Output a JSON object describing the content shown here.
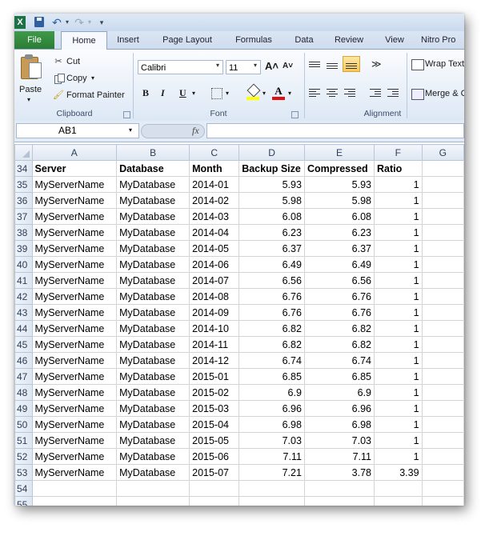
{
  "qat": {
    "app_icon": "X",
    "undo_glyph": "↶",
    "redo_glyph": "↷",
    "dropdown_glyph": "▾"
  },
  "tabs": {
    "file": "File",
    "home": "Home",
    "insert": "Insert",
    "page_layout": "Page Layout",
    "formulas": "Formulas",
    "data": "Data",
    "review": "Review",
    "view": "View",
    "nitro": "Nitro Pro"
  },
  "clipboard": {
    "paste": "Paste",
    "cut": "Cut",
    "copy": "Copy",
    "format_painter": "Format Painter",
    "label": "Clipboard"
  },
  "font": {
    "name": "Calibri",
    "size": "11",
    "grow": "A˄",
    "shrink": "A˅",
    "bold": "B",
    "italic": "I",
    "underline": "U",
    "color_letter": "A",
    "label": "Font"
  },
  "alignment": {
    "wrap_text": "Wrap Text",
    "merge": "Merge & Center",
    "label": "Alignment",
    "orientation_glyph": "≫"
  },
  "formula_bar": {
    "name_box": "AB1",
    "fx": "fx",
    "formula": ""
  },
  "sheet": {
    "columns": [
      "A",
      "B",
      "C",
      "D",
      "E",
      "F",
      "G"
    ],
    "header_row": {
      "num": "34",
      "cells": [
        "Server",
        "Database",
        "Month",
        "Backup Size",
        "Compressed",
        "Ratio",
        ""
      ]
    },
    "rows": [
      {
        "num": "35",
        "server": "MyServerName",
        "database": "MyDatabase",
        "month": "2014-01",
        "backup": "5.93",
        "compressed": "5.93",
        "ratio": "1"
      },
      {
        "num": "36",
        "server": "MyServerName",
        "database": "MyDatabase",
        "month": "2014-02",
        "backup": "5.98",
        "compressed": "5.98",
        "ratio": "1"
      },
      {
        "num": "37",
        "server": "MyServerName",
        "database": "MyDatabase",
        "month": "2014-03",
        "backup": "6.08",
        "compressed": "6.08",
        "ratio": "1"
      },
      {
        "num": "38",
        "server": "MyServerName",
        "database": "MyDatabase",
        "month": "2014-04",
        "backup": "6.23",
        "compressed": "6.23",
        "ratio": "1"
      },
      {
        "num": "39",
        "server": "MyServerName",
        "database": "MyDatabase",
        "month": "2014-05",
        "backup": "6.37",
        "compressed": "6.37",
        "ratio": "1"
      },
      {
        "num": "40",
        "server": "MyServerName",
        "database": "MyDatabase",
        "month": "2014-06",
        "backup": "6.49",
        "compressed": "6.49",
        "ratio": "1"
      },
      {
        "num": "41",
        "server": "MyServerName",
        "database": "MyDatabase",
        "month": "2014-07",
        "backup": "6.56",
        "compressed": "6.56",
        "ratio": "1"
      },
      {
        "num": "42",
        "server": "MyServerName",
        "database": "MyDatabase",
        "month": "2014-08",
        "backup": "6.76",
        "compressed": "6.76",
        "ratio": "1"
      },
      {
        "num": "43",
        "server": "MyServerName",
        "database": "MyDatabase",
        "month": "2014-09",
        "backup": "6.76",
        "compressed": "6.76",
        "ratio": "1"
      },
      {
        "num": "44",
        "server": "MyServerName",
        "database": "MyDatabase",
        "month": "2014-10",
        "backup": "6.82",
        "compressed": "6.82",
        "ratio": "1"
      },
      {
        "num": "45",
        "server": "MyServerName",
        "database": "MyDatabase",
        "month": "2014-11",
        "backup": "6.82",
        "compressed": "6.82",
        "ratio": "1"
      },
      {
        "num": "46",
        "server": "MyServerName",
        "database": "MyDatabase",
        "month": "2014-12",
        "backup": "6.74",
        "compressed": "6.74",
        "ratio": "1"
      },
      {
        "num": "47",
        "server": "MyServerName",
        "database": "MyDatabase",
        "month": "2015-01",
        "backup": "6.85",
        "compressed": "6.85",
        "ratio": "1"
      },
      {
        "num": "48",
        "server": "MyServerName",
        "database": "MyDatabase",
        "month": "2015-02",
        "backup": "6.9",
        "compressed": "6.9",
        "ratio": "1"
      },
      {
        "num": "49",
        "server": "MyServerName",
        "database": "MyDatabase",
        "month": "2015-03",
        "backup": "6.96",
        "compressed": "6.96",
        "ratio": "1"
      },
      {
        "num": "50",
        "server": "MyServerName",
        "database": "MyDatabase",
        "month": "2015-04",
        "backup": "6.98",
        "compressed": "6.98",
        "ratio": "1"
      },
      {
        "num": "51",
        "server": "MyServerName",
        "database": "MyDatabase",
        "month": "2015-05",
        "backup": "7.03",
        "compressed": "7.03",
        "ratio": "1"
      },
      {
        "num": "52",
        "server": "MyServerName",
        "database": "MyDatabase",
        "month": "2015-06",
        "backup": "7.11",
        "compressed": "7.11",
        "ratio": "1"
      },
      {
        "num": "53",
        "server": "MyServerName",
        "database": "MyDatabase",
        "month": "2015-07",
        "backup": "7.21",
        "compressed": "3.78",
        "ratio": "3.39"
      }
    ],
    "empty_rows": [
      "54",
      "55"
    ]
  },
  "colors": {
    "file_tab": "#2a7d33",
    "selected_align": "#f7c95a",
    "fill_color": "#ffff00",
    "font_color": "#e01010"
  }
}
